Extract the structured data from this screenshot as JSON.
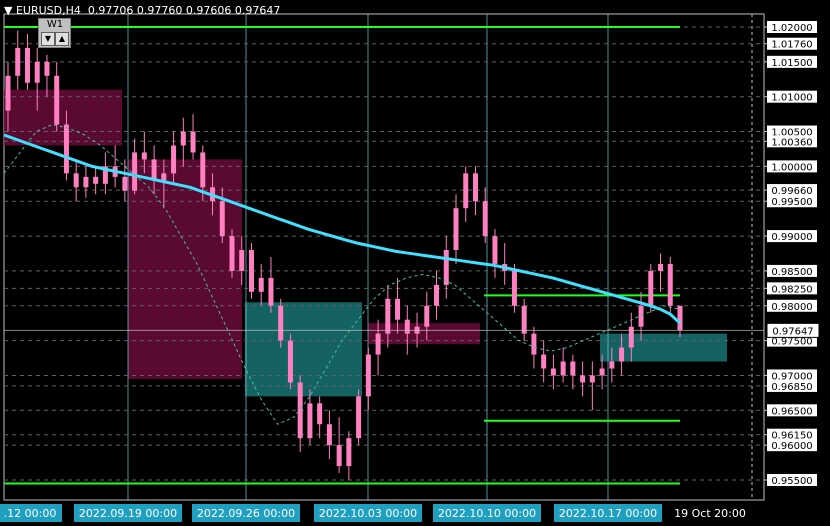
{
  "header": {
    "symbol": "EURUSD,H4",
    "ohlc": "0.97706 0.97760 0.97606 0.97647",
    "menu_icon": "triangle-down-icon"
  },
  "timeframe_box": {
    "label": "W1",
    "down_icon": "triangle-down-icon",
    "up_icon": "triangle-up-icon"
  },
  "colors": {
    "background": "#000000",
    "candle": "#ff80c0",
    "ma": "#40e0ff",
    "level": "#20ff20",
    "supply_zone": "#6a0a3a",
    "demand_zone": "#1a7a7a",
    "axis_text": "#000000",
    "axis_label_bg": "#ffffff",
    "time_label_bg": "#20a0c0"
  },
  "chart_data": {
    "type": "candlestick",
    "symbol": "EURUSD",
    "timeframe": "H4",
    "current_price": "0.97647",
    "y_ticks": [
      "1.02000",
      "1.01760",
      "1.01500",
      "1.01000",
      "1.00500",
      "1.00360",
      "1.00000",
      "0.99660",
      "0.99500",
      "0.99000",
      "0.98500",
      "0.98250",
      "0.98000",
      "0.97500",
      "0.97000",
      "0.96850",
      "0.96500",
      "0.96150",
      "0.96000",
      "0.95500"
    ],
    "ylim": [
      0.954,
      1.0215
    ],
    "x_tick_labels": [
      ".12 00:00",
      "2022.09.19 00:00",
      "2022.09.26 00:00",
      "2022.10.03 00:00",
      "2022.10.10 00:00",
      "2022.10.17 00:00",
      "19 Oct 20:00"
    ],
    "series": [
      {
        "type": "candlestick",
        "values": [
          [
            1.008,
            1.015,
            1.005,
            1.013
          ],
          [
            1.013,
            1.0195,
            1.011,
            1.017
          ],
          [
            1.017,
            1.019,
            1.011,
            1.012
          ],
          [
            1.012,
            1.017,
            1.008,
            1.015
          ],
          [
            1.015,
            1.016,
            1.01,
            1.013
          ],
          [
            1.013,
            1.015,
            1.005,
            1.006
          ],
          [
            1.006,
            1.008,
            0.998,
            0.999
          ],
          [
            0.999,
            1.001,
            0.995,
            0.997
          ],
          [
            0.997,
            1.0,
            0.9955,
            0.9985
          ],
          [
            0.9985,
            1.0,
            0.996,
            0.9975
          ],
          [
            0.9975,
            1.002,
            0.996,
            1.0
          ],
          [
            1.0,
            1.003,
            0.997,
            0.9985
          ],
          [
            0.9985,
            1.001,
            0.995,
            0.9965
          ],
          [
            0.9965,
            1.004,
            0.996,
            1.002
          ],
          [
            1.002,
            1.005,
            0.999,
            1.001
          ],
          [
            1.001,
            1.003,
            0.996,
            0.998
          ],
          [
            0.998,
            1.001,
            0.994,
            0.999
          ],
          [
            0.999,
            1.005,
            0.9975,
            1.003
          ],
          [
            1.003,
            1.007,
            1.0,
            1.005
          ],
          [
            1.005,
            1.0075,
            1.001,
            1.002
          ],
          [
            1.002,
            1.003,
            0.995,
            0.997
          ],
          [
            0.997,
            0.999,
            0.993,
            0.995
          ],
          [
            0.995,
            0.997,
            0.989,
            0.99
          ],
          [
            0.99,
            0.991,
            0.984,
            0.985
          ],
          [
            0.985,
            0.99,
            0.983,
            0.988
          ],
          [
            0.988,
            0.989,
            0.981,
            0.982
          ],
          [
            0.982,
            0.986,
            0.98,
            0.984
          ],
          [
            0.984,
            0.987,
            0.979,
            0.98
          ],
          [
            0.98,
            0.981,
            0.974,
            0.975
          ],
          [
            0.975,
            0.976,
            0.968,
            0.969
          ],
          [
            0.969,
            0.97,
            0.959,
            0.961
          ],
          [
            0.961,
            0.968,
            0.96,
            0.966
          ],
          [
            0.966,
            0.967,
            0.961,
            0.963
          ],
          [
            0.963,
            0.965,
            0.958,
            0.96
          ],
          [
            0.96,
            0.964,
            0.956,
            0.957
          ],
          [
            0.957,
            0.962,
            0.955,
            0.961
          ],
          [
            0.961,
            0.968,
            0.96,
            0.967
          ],
          [
            0.967,
            0.974,
            0.965,
            0.973
          ],
          [
            0.973,
            0.978,
            0.97,
            0.976
          ],
          [
            0.976,
            0.983,
            0.974,
            0.981
          ],
          [
            0.981,
            0.984,
            0.976,
            0.978
          ],
          [
            0.978,
            0.98,
            0.973,
            0.976
          ],
          [
            0.976,
            0.979,
            0.974,
            0.977
          ],
          [
            0.977,
            0.982,
            0.975,
            0.98
          ],
          [
            0.98,
            0.985,
            0.978,
            0.983
          ],
          [
            0.983,
            0.99,
            0.981,
            0.988
          ],
          [
            0.988,
            0.996,
            0.986,
            0.994
          ],
          [
            0.994,
            1.0,
            0.992,
            0.999
          ],
          [
            0.999,
            1.0,
            0.993,
            0.995
          ],
          [
            0.995,
            0.997,
            0.989,
            0.99
          ],
          [
            0.99,
            0.991,
            0.984,
            0.986
          ],
          [
            0.986,
            0.989,
            0.983,
            0.985
          ],
          [
            0.985,
            0.986,
            0.979,
            0.98
          ],
          [
            0.98,
            0.981,
            0.975,
            0.976
          ],
          [
            0.976,
            0.977,
            0.971,
            0.973
          ],
          [
            0.973,
            0.975,
            0.969,
            0.971
          ],
          [
            0.971,
            0.973,
            0.968,
            0.97
          ],
          [
            0.97,
            0.974,
            0.969,
            0.972
          ],
          [
            0.972,
            0.973,
            0.968,
            0.97
          ],
          [
            0.97,
            0.972,
            0.967,
            0.969
          ],
          [
            0.969,
            0.972,
            0.965,
            0.97
          ],
          [
            0.97,
            0.973,
            0.968,
            0.971
          ],
          [
            0.971,
            0.974,
            0.969,
            0.972
          ],
          [
            0.972,
            0.976,
            0.97,
            0.974
          ],
          [
            0.974,
            0.979,
            0.972,
            0.977
          ],
          [
            0.977,
            0.982,
            0.975,
            0.98
          ],
          [
            0.98,
            0.986,
            0.979,
            0.985
          ],
          [
            0.985,
            0.9875,
            0.982,
            0.986
          ],
          [
            0.986,
            0.987,
            0.979,
            0.98
          ],
          [
            0.98,
            0.98,
            0.9755,
            0.9765
          ]
        ]
      },
      {
        "type": "line",
        "values": [
          1.0045,
          1.004,
          1.0035,
          1.003,
          1.0025,
          1.002,
          1.0015,
          1.001,
          1.0005,
          1.0,
          0.9997,
          0.9994,
          0.9991,
          0.9988,
          0.9985,
          0.9982,
          0.9979,
          0.9976,
          0.9973,
          0.997,
          0.9965,
          0.996,
          0.9955,
          0.995,
          0.9945,
          0.994,
          0.9935,
          0.993,
          0.9925,
          0.992,
          0.9915,
          0.991,
          0.9906,
          0.9902,
          0.9898,
          0.9894,
          0.989,
          0.9887,
          0.9884,
          0.9881,
          0.9878,
          0.9876,
          0.9874,
          0.9872,
          0.987,
          0.9868,
          0.9866,
          0.9864,
          0.9862,
          0.986,
          0.9858,
          0.9855,
          0.9852,
          0.9849,
          0.9846,
          0.9843,
          0.984,
          0.9836,
          0.9832,
          0.9828,
          0.9824,
          0.982,
          0.9816,
          0.9812,
          0.9808,
          0.9804,
          0.98,
          0.9795,
          0.9788,
          0.9775
        ]
      },
      {
        "type": "dashed",
        "values": [
          0.999,
          1.002,
          1.005,
          1.006,
          1.0055,
          1.0045,
          1.003,
          1.001,
          0.999,
          0.997,
          0.994,
          0.99,
          0.986,
          0.981,
          0.976,
          0.971,
          0.9665,
          0.963,
          0.964,
          0.967,
          0.971,
          0.975,
          0.978,
          0.981,
          0.983,
          0.984,
          0.9845,
          0.984,
          0.983,
          0.981,
          0.979,
          0.977,
          0.975,
          0.974,
          0.9735,
          0.974,
          0.975,
          0.976,
          0.977,
          0.978,
          0.979,
          0.98,
          0.9795
        ]
      }
    ],
    "levels": [
      1.02,
      0.9815,
      0.9635,
      0.9545
    ],
    "zones": [
      {
        "kind": "supply",
        "top": 1.011,
        "bottom": 1.003
      },
      {
        "kind": "supply",
        "top": 1.001,
        "bottom": 0.9695
      },
      {
        "kind": "demand",
        "top": 0.9805,
        "bottom": 0.967
      },
      {
        "kind": "supply",
        "top": 0.9775,
        "bottom": 0.9745
      },
      {
        "kind": "demand",
        "top": 0.976,
        "bottom": 0.972
      }
    ]
  }
}
